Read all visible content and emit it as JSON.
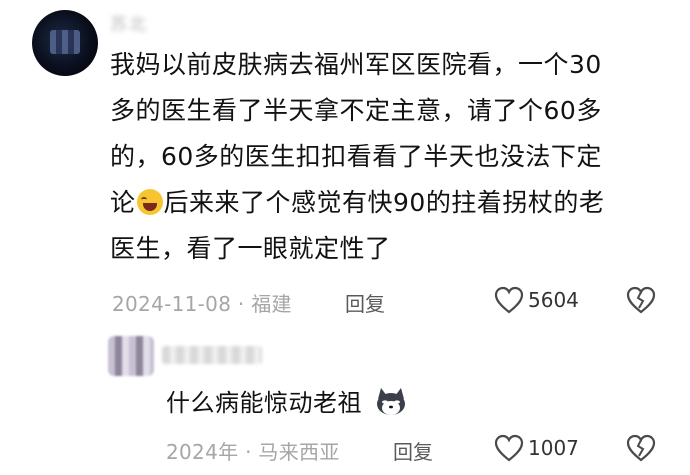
{
  "comment": {
    "author_name": "苏北",
    "text_line1": "我妈以前皮肤病去福州军区医院看，一个30",
    "text_line2": "多的医生看了半天拿不定主意，请了个60多",
    "text_line3": "的，60多的医生扣扣看看了半天也没法下定",
    "text_line4a": "论",
    "text_line4b": "后来来了个感觉有快90的拄着拐杖的老",
    "text_line5": "医生，看了一眼就定性了",
    "emoji_icon": "laugh-crying-emoji",
    "date": "2024-11-08",
    "separator": "·",
    "location": "福建",
    "reply_label": "回复",
    "like_count": "5604"
  },
  "reply": {
    "text": "什么病能惊动老祖",
    "emoji_icon": "dog-emoji",
    "date": "2024年",
    "separator": "·",
    "location": "马来西亚",
    "reply_label": "回复",
    "like_count": "1007"
  },
  "colors": {
    "text": "#121212",
    "meta": "#a6a6a6"
  }
}
